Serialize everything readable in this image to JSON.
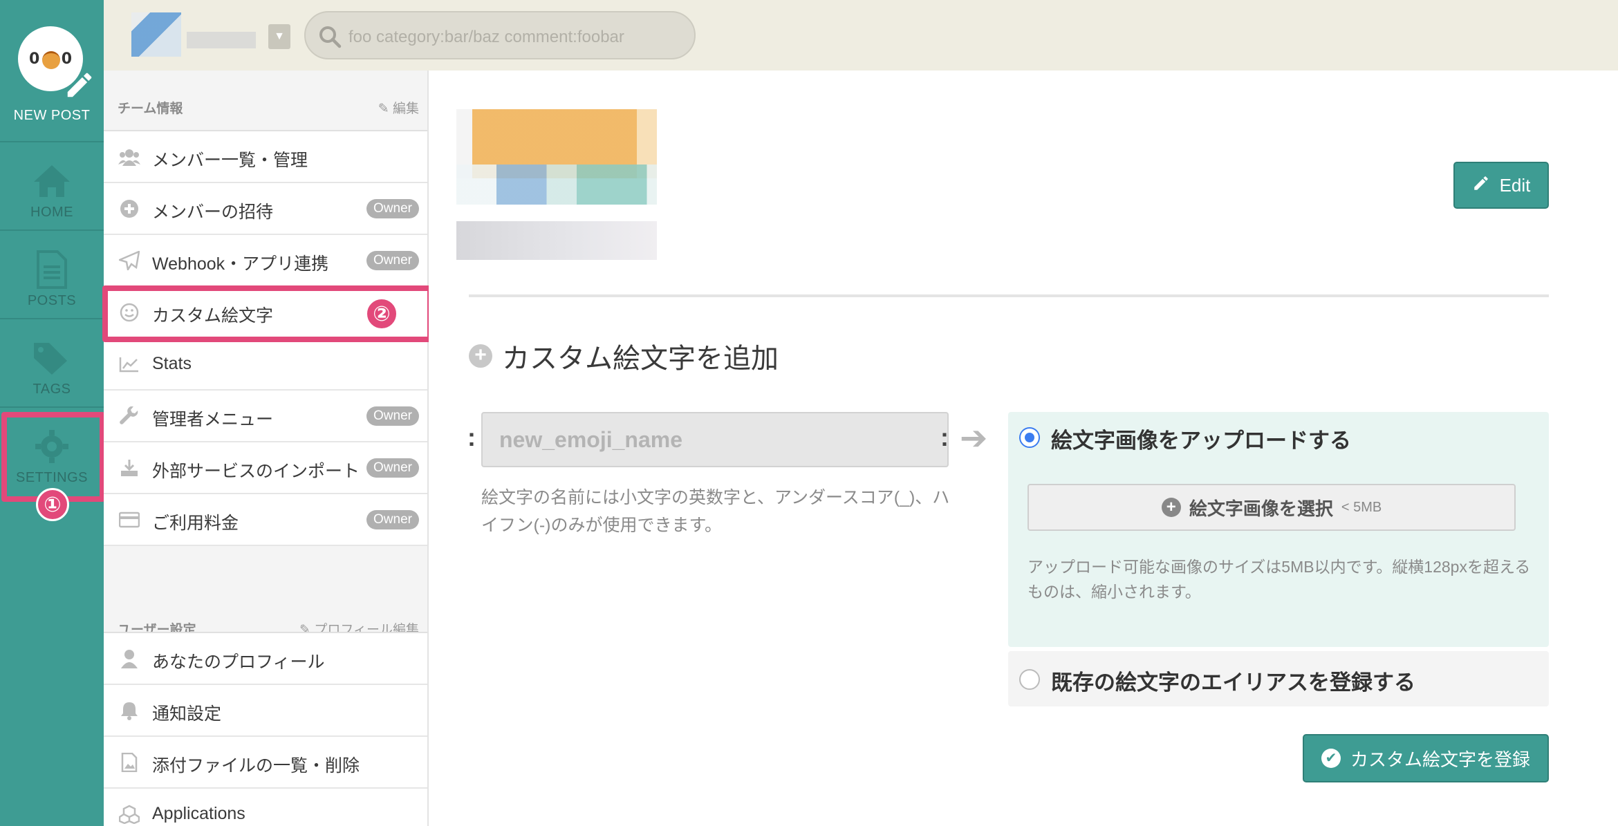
{
  "rail": {
    "new_post_label": "NEW POST",
    "logo_face": [
      "0",
      "0"
    ],
    "items": [
      {
        "label": "HOME",
        "icon": "home-icon"
      },
      {
        "label": "POSTS",
        "icon": "document-icon"
      },
      {
        "label": "TAGS",
        "icon": "tags-icon"
      },
      {
        "label": "SETTINGS",
        "icon": "gear-icon"
      }
    ],
    "annotation_1": "①"
  },
  "topbar": {
    "search_placeholder": "foo category:bar/baz comment:foobar",
    "dropdown_icon": "caret-down-icon"
  },
  "sidebar": {
    "team_section_title": "チーム情報",
    "team_section_edit": "編集",
    "team_items": [
      {
        "label": "メンバー一覧・管理",
        "icon": "users-icon",
        "badge": ""
      },
      {
        "label": "メンバーの招待",
        "icon": "plus-circle-icon",
        "badge": "Owner"
      },
      {
        "label": "Webhook・アプリ連携",
        "icon": "paper-plane-icon",
        "badge": "Owner"
      },
      {
        "label": "カスタム絵文字",
        "icon": "smiley-icon",
        "badge": ""
      },
      {
        "label": "Stats",
        "icon": "line-chart-icon",
        "badge": ""
      },
      {
        "label": "管理者メニュー",
        "icon": "wrench-icon",
        "badge": "Owner"
      },
      {
        "label": "外部サービスのインポート",
        "icon": "download-icon",
        "badge": "Owner"
      },
      {
        "label": "ご利用料金",
        "icon": "credit-card-icon",
        "badge": "Owner"
      }
    ],
    "user_section_title": "ユーザー設定",
    "user_section_edit": "プロフィール編集",
    "user_items": [
      {
        "label": "あなたのプロフィール",
        "icon": "user-icon"
      },
      {
        "label": "通知設定",
        "icon": "bell-icon"
      },
      {
        "label": "添付ファイルの一覧・削除",
        "icon": "image-file-icon"
      },
      {
        "label": "Applications",
        "icon": "cubes-icon"
      }
    ],
    "annotation_2": "②"
  },
  "main": {
    "edit_button": "Edit",
    "section_title": "カスタム絵文字を追加",
    "colon": ":",
    "name_placeholder": "new_emoji_name",
    "name_hint": "絵文字の名前には小文字の英数字と、アンダースコア(_)、ハイフン(-)のみが使用できます。",
    "upload_option": "絵文字画像をアップロードする",
    "select_button": "絵文字画像を選択",
    "select_size": "< 5MB",
    "upload_hint": "アップロード可能な画像のサイズは5MB以内です。縦横128pxを超えるものは、縮小されます。",
    "alias_option": "既存の絵文字のエイリアスを登録する",
    "submit_button": "カスタム絵文字を登録"
  },
  "colors": {
    "brand_teal": "#3e9c93",
    "topbar_bg": "#efede1",
    "annotation_pink": "#e2497a",
    "radio_blue": "#3b7cf0"
  }
}
